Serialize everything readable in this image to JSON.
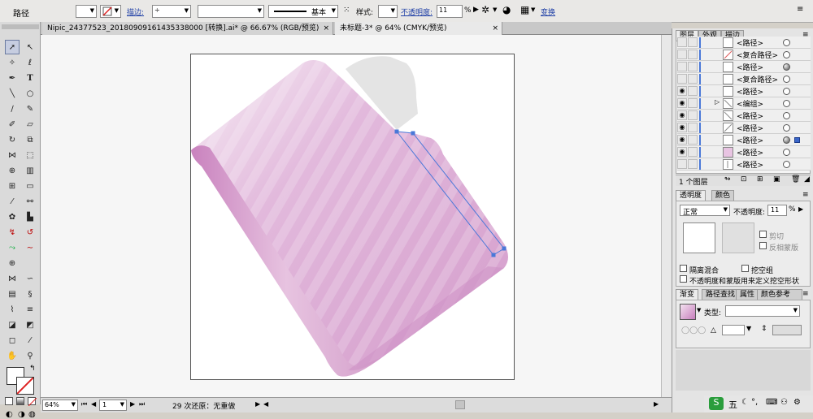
{
  "control_bar": {
    "object_label": "路径",
    "stroke_label": "描边:",
    "stroke_style": "基本",
    "style_label": "样式:",
    "opacity_label": "不透明度:",
    "opacity_value": "11",
    "opacity_unit": "%",
    "transform_label": "变换"
  },
  "tabs": [
    {
      "label": "Nipic_24377523_20180909161435338000 [转换].ai* @ 66.67% (RGB/预览)",
      "close": "×"
    },
    {
      "label": "未标题-3* @ 64% (CMYK/预览)",
      "close": "×"
    }
  ],
  "status_bar": {
    "zoom": "64%",
    "page": "1",
    "undo_info": "29 次还原：无重做"
  },
  "layers_panel": {
    "tabs": [
      "图层",
      "外观",
      "描边"
    ],
    "rows": [
      {
        "name": "<路径>",
        "eye": false,
        "target": "empty",
        "selected": false,
        "arrow": false
      },
      {
        "name": "<复合路径>",
        "eye": false,
        "target": "empty",
        "selected": false,
        "arrow": false
      },
      {
        "name": "<路径>",
        "eye": false,
        "target": "filled",
        "selected": false,
        "arrow": false
      },
      {
        "name": "<复合路径>",
        "eye": false,
        "target": "empty",
        "selected": false,
        "arrow": false
      },
      {
        "name": "<路径>",
        "eye": true,
        "target": "empty",
        "selected": false,
        "arrow": false
      },
      {
        "name": "<编组>",
        "eye": true,
        "target": "empty",
        "selected": false,
        "arrow": true
      },
      {
        "name": "<路径>",
        "eye": true,
        "target": "empty",
        "selected": false,
        "arrow": false
      },
      {
        "name": "<路径>",
        "eye": true,
        "target": "empty",
        "selected": false,
        "arrow": false
      },
      {
        "name": "<路径>",
        "eye": true,
        "target": "filled",
        "selected": true,
        "arrow": false
      },
      {
        "name": "<路径>",
        "eye": true,
        "target": "empty",
        "selected": false,
        "arrow": false
      },
      {
        "name": "<路径>",
        "eye": false,
        "target": "empty",
        "selected": false,
        "arrow": false
      }
    ],
    "footer_count": "1 个图层"
  },
  "transparency_panel": {
    "tabs": [
      "透明度",
      "颜色"
    ],
    "blend_mode": "正常",
    "opacity_label": "不透明度:",
    "opacity_value": "11",
    "opacity_unit": "%",
    "clip_label": "剪切",
    "invert_mask_label": "反相蒙版",
    "isolate_blend_label": "隔离混合",
    "knockout_group_label": "挖空组",
    "opacity_mask_label": "不透明度和蒙版用来定义挖空形状"
  },
  "gradient_panel": {
    "tabs": [
      "渐变",
      "路径查找",
      "属性",
      "颜色参考"
    ],
    "type_label": "类型:"
  },
  "taskbar": {
    "ime_label": "五"
  },
  "colors": {
    "selection_blue": "#4a78d8",
    "folder_pink": "#d9a6d2",
    "folder_tab_gray": "#e4e4e4"
  }
}
